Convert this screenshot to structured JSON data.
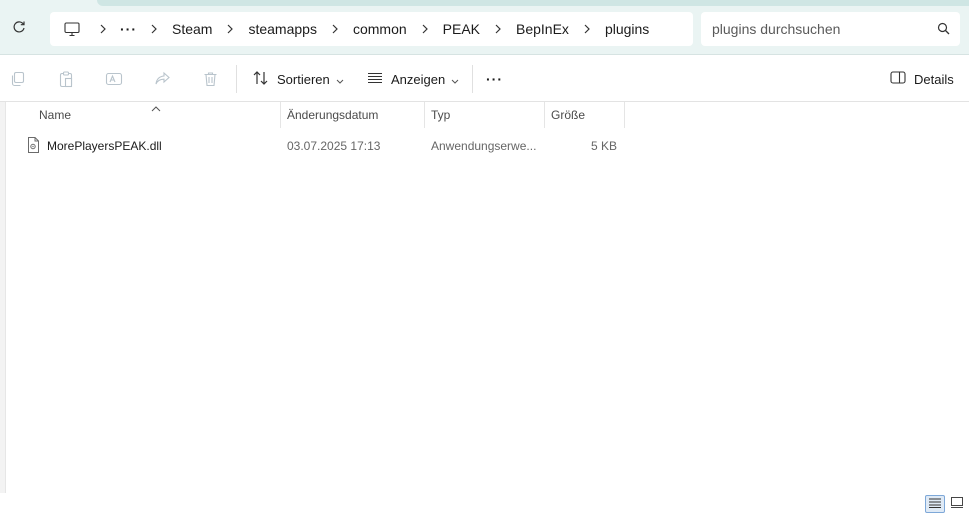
{
  "address": {
    "breadcrumbs": [
      "Steam",
      "steamapps",
      "common",
      "PEAK",
      "BepInEx",
      "plugins"
    ],
    "overflow_label": "···"
  },
  "search": {
    "placeholder": "plugins durchsuchen"
  },
  "toolbar": {
    "sort_label": "Sortieren",
    "view_label": "Anzeigen",
    "more_label": "···",
    "details_label": "Details"
  },
  "columns": {
    "name": "Name",
    "date": "Änderungsdatum",
    "type": "Typ",
    "size": "Größe"
  },
  "files": [
    {
      "name": "MorePlayersPEAK.dll",
      "date": "03.07.2025 17:13",
      "type": "Anwendungserwe...",
      "size": "5 KB"
    }
  ],
  "colors": {
    "address_bg": "#eaf4f3",
    "accent_strip": "#cfe6e4",
    "view_active": "#dfeaf6"
  }
}
